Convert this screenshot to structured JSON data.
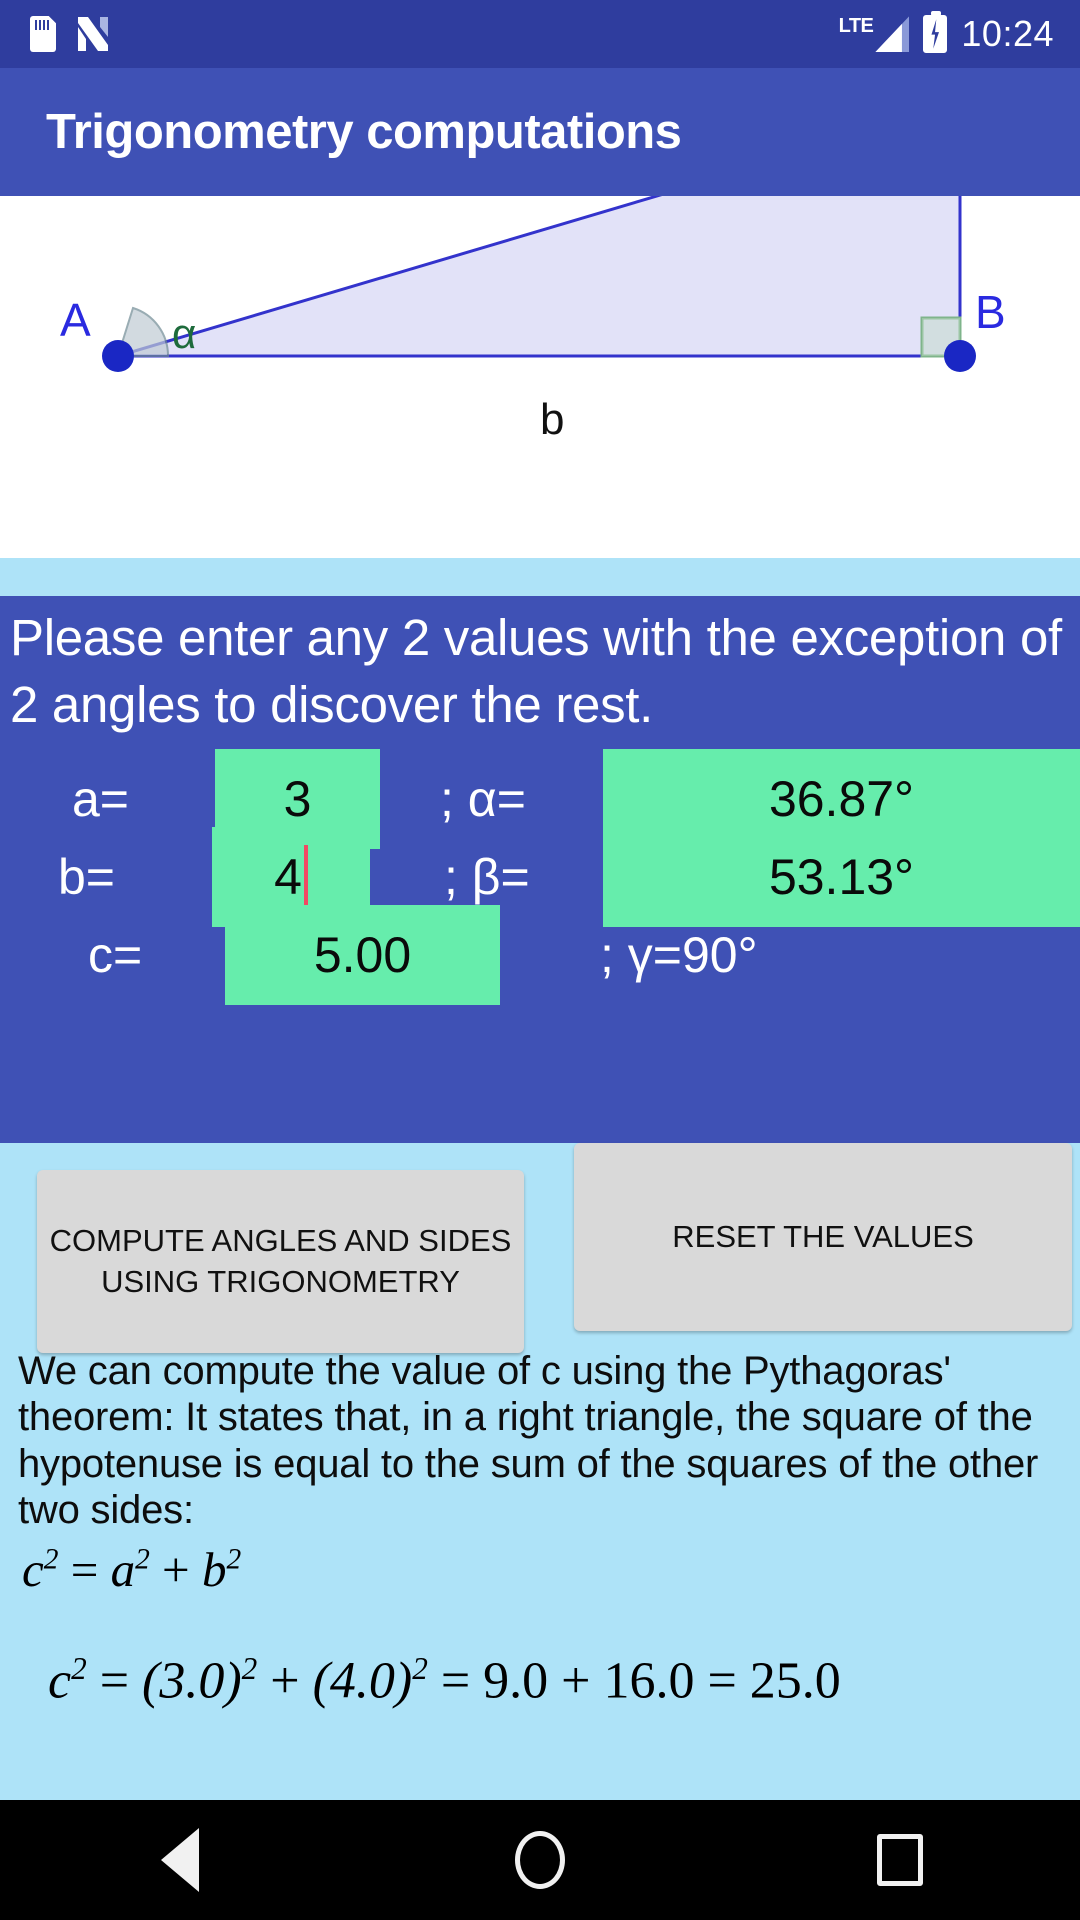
{
  "status_bar": {
    "icons": [
      "sd-card-icon",
      "nfc-icon",
      "lte-signal-icon",
      "battery-charging-icon"
    ],
    "lte_label": "LTE",
    "time": "10:24"
  },
  "app_bar": {
    "title": "Trigonometry computations"
  },
  "diagram": {
    "vertex_a_label": "A",
    "vertex_b_label": "B",
    "angle_alpha_label": "α",
    "side_b_label": "b",
    "stroke_color": "#3333CC",
    "fill_color": "#E2E2F8",
    "angle_color": "#1E6B3C",
    "vertex_color": "#1A27C4"
  },
  "panel": {
    "instructions": "Please enter any 2 values with the exception of 2 angles to discover the rest.",
    "rows": [
      {
        "side_label": "a=",
        "side_value": "3",
        "angle_label": "; α=",
        "angle_value": "36.87°",
        "focused": false
      },
      {
        "side_label": "b=",
        "side_value": "4",
        "angle_label": "; β=",
        "angle_value": "53.13°",
        "focused": true
      },
      {
        "side_label": "c=",
        "side_value": "5.00",
        "angle_label": ";  γ=90°",
        "angle_value": "",
        "focused": false
      }
    ],
    "field_color": "#66EDAC",
    "panel_color": "#3F51B5",
    "caret_color": "#F04A63"
  },
  "buttons": {
    "compute_label": "COMPUTE ANGLES AND SIDES USING TRIGONOMETRY",
    "reset_label": "RESET THE VALUES"
  },
  "explanation": {
    "text": "We can compute the value of c using the Pythagoras' theorem: It states that, in a right triangle, the square of the hypotenuse is equal to the sum of the squares of the other two sides:",
    "formula_general": "c² = a² + b²",
    "formula_numeric": "c² = (3.0)² + (4.0)² = 9.0 + 16.0 = 25.0"
  },
  "nav_bar": {
    "back": "back-icon",
    "home": "home-icon",
    "recents": "recents-icon"
  }
}
